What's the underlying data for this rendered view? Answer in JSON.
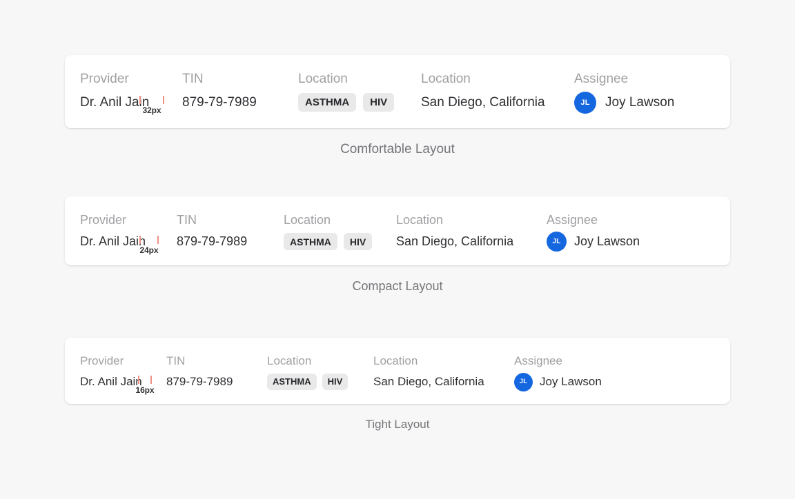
{
  "page": {
    "background_color": "#f7f7f8"
  },
  "theme": {
    "card_background": "#ffffff",
    "label_color": "#a0a0a4",
    "value_color": "#2f3033",
    "tag_background": "#e9e9ea",
    "tag_text_color": "#27282b",
    "avatar_color": "#1567e0",
    "measure_color": "#ef9084",
    "caption_color": "#757579"
  },
  "variants": [
    {
      "id": "comfortable",
      "caption": "Comfortable Layout",
      "measurement": "32px",
      "columns": {
        "provider": {
          "label": "Provider",
          "value": "Dr. Anil Jain"
        },
        "tin": {
          "label": "TIN",
          "value": "879-79-7989"
        },
        "tags": {
          "label": "Location",
          "items": [
            "ASTHMA",
            "HIV"
          ]
        },
        "location": {
          "label": "Location",
          "value": "San Diego, California"
        },
        "assignee": {
          "label": "Assignee",
          "initials": "JL",
          "name": "Joy Lawson"
        }
      }
    },
    {
      "id": "compact",
      "caption": "Compact Layout",
      "measurement": "24px",
      "columns": {
        "provider": {
          "label": "Provider",
          "value": "Dr. Anil Jain"
        },
        "tin": {
          "label": "TIN",
          "value": "879-79-7989"
        },
        "tags": {
          "label": "Location",
          "items": [
            "ASTHMA",
            "HIV"
          ]
        },
        "location": {
          "label": "Location",
          "value": "San Diego, California"
        },
        "assignee": {
          "label": "Assignee",
          "initials": "JL",
          "name": "Joy Lawson"
        }
      }
    },
    {
      "id": "tight",
      "caption": "Tight Layout",
      "measurement": "16px",
      "columns": {
        "provider": {
          "label": "Provider",
          "value": "Dr. Anil Jain"
        },
        "tin": {
          "label": "TIN",
          "value": "879-79-7989"
        },
        "tags": {
          "label": "Location",
          "items": [
            "ASTHMA",
            "HIV"
          ]
        },
        "location": {
          "label": "Location",
          "value": "San Diego, California"
        },
        "assignee": {
          "label": "Assignee",
          "initials": "JL",
          "name": "Joy Lawson"
        }
      }
    }
  ]
}
